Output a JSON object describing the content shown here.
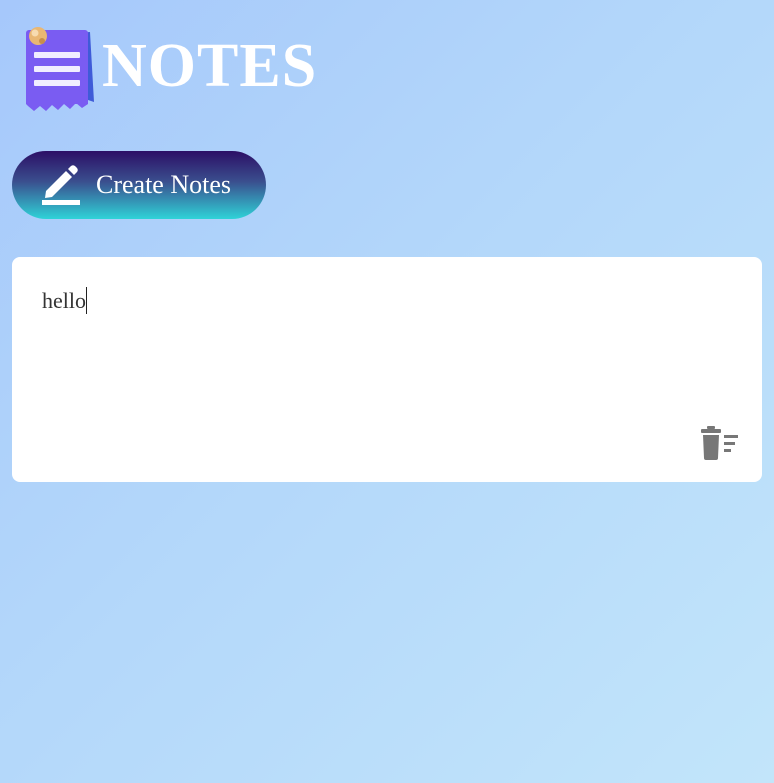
{
  "app": {
    "title": "NOTES",
    "logo_icon": "notepad-icon"
  },
  "toolbar": {
    "create_label": "Create Notes",
    "create_icon": "pencil-icon"
  },
  "notes": [
    {
      "text": "hello",
      "delete_icon": "trash-icon"
    }
  ],
  "colors": {
    "background_start": "#a6c8fb",
    "background_end": "#c2e5fa",
    "button_top": "#2c0f66",
    "button_bottom": "#2fd3d8",
    "logo_purple": "#7b5cf0",
    "icon_gray": "#777777"
  }
}
